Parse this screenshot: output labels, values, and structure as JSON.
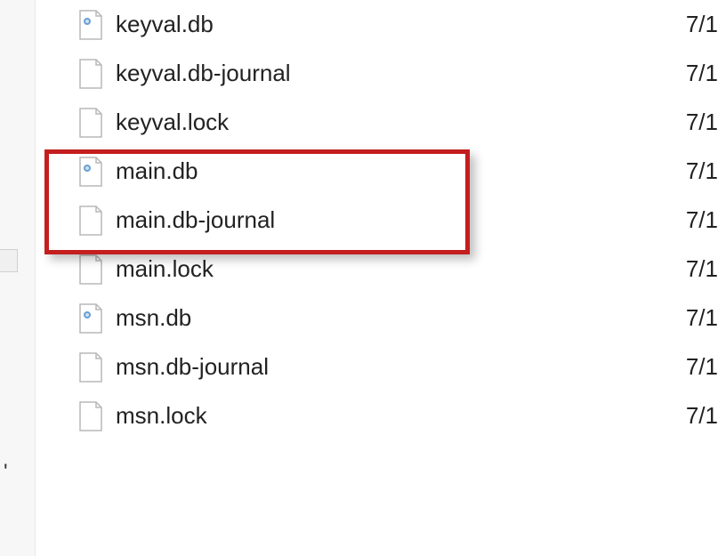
{
  "sidebar": {
    "fragment": "'"
  },
  "files": [
    {
      "name": "keyval.db",
      "date": "7/1",
      "icon": "db"
    },
    {
      "name": "keyval.db-journal",
      "date": "7/1",
      "icon": "file"
    },
    {
      "name": "keyval.lock",
      "date": "7/1",
      "icon": "file"
    },
    {
      "name": "main.db",
      "date": "7/1",
      "icon": "db"
    },
    {
      "name": "main.db-journal",
      "date": "7/1",
      "icon": "file"
    },
    {
      "name": "main.lock",
      "date": "7/1",
      "icon": "file"
    },
    {
      "name": "msn.db",
      "date": "7/1",
      "icon": "db"
    },
    {
      "name": "msn.db-journal",
      "date": "7/1",
      "icon": "file"
    },
    {
      "name": "msn.lock",
      "date": "7/1",
      "icon": "file"
    }
  ],
  "highlight": {
    "start_index": 3,
    "end_index": 4
  }
}
